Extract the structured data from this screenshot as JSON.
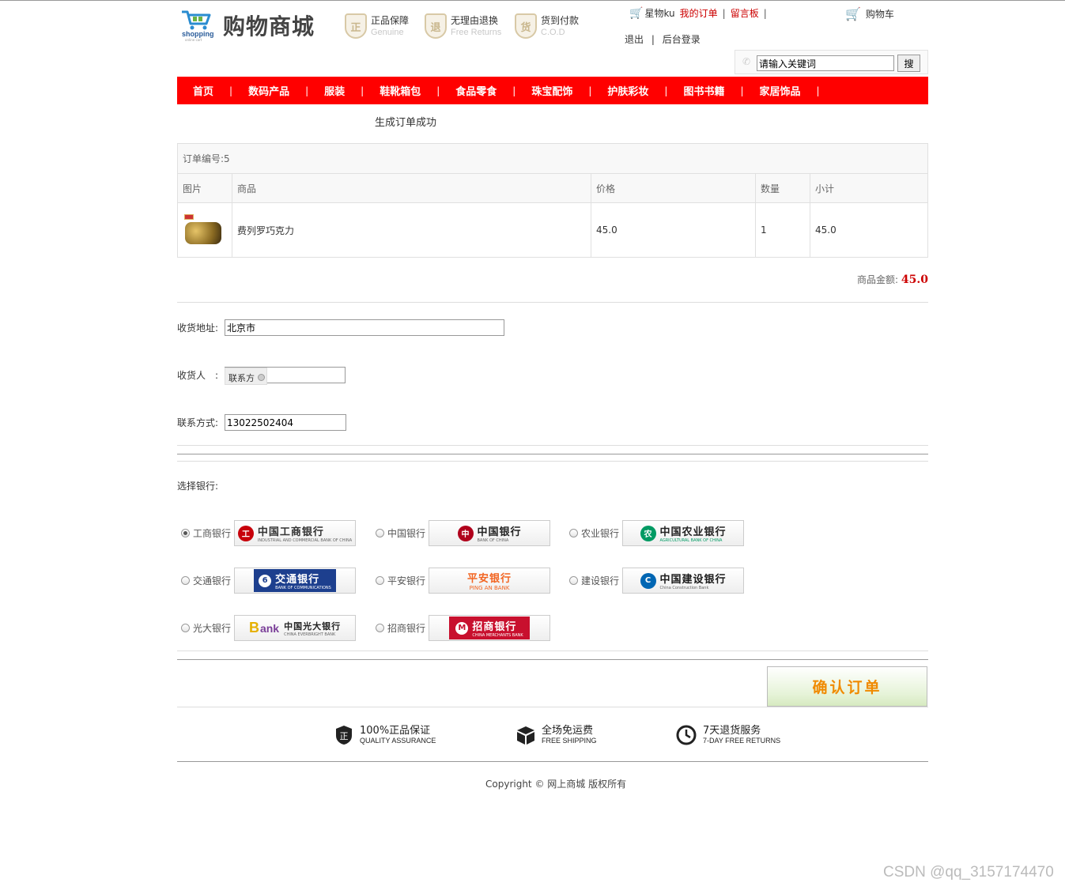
{
  "header": {
    "logo_word": "shopping",
    "logo_sub": "online cart",
    "title": "购物商城",
    "promises": [
      {
        "icon": "genuine-badge-icon",
        "badge": "正",
        "title": "正品保障",
        "sub": "Genuine"
      },
      {
        "icon": "returns-badge-icon",
        "badge": "退",
        "title": "无理由退换",
        "sub": "Free Returns"
      },
      {
        "icon": "cod-badge-icon",
        "badge": "货",
        "title": "货到付款",
        "sub": "C.O.D"
      }
    ],
    "user_links": {
      "user": "星物ku",
      "my_orders": "我的订单",
      "message_board": "留言板",
      "logout": "退出",
      "admin_login": "后台登录",
      "cart": "购物车"
    },
    "search": {
      "value": "请输入关键词",
      "button": "搜"
    }
  },
  "nav": [
    "首页",
    "数码产品",
    "服装",
    "鞋靴箱包",
    "食品零食",
    "珠宝配饰",
    "护肤彩妆",
    "图书书籍",
    "家居饰品"
  ],
  "status_message": "生成订单成功",
  "order": {
    "number_label": "订单编号:5",
    "columns": [
      "图片",
      "商品",
      "价格",
      "数量",
      "小计"
    ],
    "items": [
      {
        "image": "chocolate-image",
        "name": "费列罗巧克力",
        "price": "45.0",
        "qty": "1",
        "subtotal": "45.0"
      }
    ],
    "total_label": "商品金额:",
    "total": "45.0"
  },
  "form": {
    "address_label": "收货地址:",
    "address_value": "北京市",
    "receiver_label": "收货人　:",
    "receiver_overlay": "联系方",
    "receiver_value": "",
    "phone_label": "联系方式:",
    "phone_value": "13022502404"
  },
  "bank_section": {
    "label": "选择银行:",
    "banks": [
      {
        "name": "工商银行",
        "logo_text": "中国工商银行",
        "logo_sub": "INDUSTRIAL AND COMMERCIAL BANK OF CHINA",
        "color": "#c7000b",
        "checked": true
      },
      {
        "name": "中国银行",
        "logo_text": "中国银行",
        "logo_sub": "BANK OF CHINA",
        "color": "#b0001c",
        "checked": false
      },
      {
        "name": "农业银行",
        "logo_text": "中国农业银行",
        "logo_sub": "AGRICULTURAL BANK OF CHINA",
        "color": "#009a63",
        "checked": false
      },
      {
        "name": "交通银行",
        "logo_text": "交通银行",
        "logo_sub": "BANK OF COMMUNICATIONS",
        "color": "#1d3f8e",
        "checked": false
      },
      {
        "name": "平安银行",
        "logo_text": "平安银行",
        "logo_sub": "PING AN BANK",
        "color": "#f26522",
        "checked": false
      },
      {
        "name": "建设银行",
        "logo_text": "中国建设银行",
        "logo_sub": "China Construction Bank",
        "color": "#0066b3",
        "checked": false
      },
      {
        "name": "光大银行",
        "logo_text": "中国光大银行",
        "logo_sub": "CHINA EVERBRIGHT BANK",
        "color": "#e5b000",
        "checked": false
      },
      {
        "name": "招商银行",
        "logo_text": "招商银行",
        "logo_sub": "CHINA MERCHANTS BANK",
        "color": "#c8102e",
        "checked": false
      }
    ]
  },
  "confirm_button": "确认订单",
  "footer": {
    "services": [
      {
        "icon": "shield-icon",
        "title": "100%正品保证",
        "sub": "QUALITY ASSURANCE"
      },
      {
        "icon": "box-icon",
        "title": "全场免运费",
        "sub": "FREE SHIPPING"
      },
      {
        "icon": "clock-icon",
        "title": "7天退货服务",
        "sub": "7-DAY FREE RETURNS"
      }
    ],
    "copyright": "Copyright © 网上商城 版权所有"
  },
  "watermark": "CSDN @qq_3157174470"
}
